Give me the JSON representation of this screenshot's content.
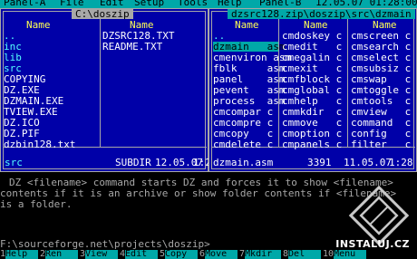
{
  "menu": {
    "items": [
      "Panel-A",
      "File",
      "Edit",
      "Setup",
      "Tools",
      "Help",
      "Panel-B"
    ],
    "clock": "12.05.07 01:28:00"
  },
  "left_panel": {
    "path": "C:\\doszip",
    "col_header_1": "Name",
    "col_header_2": "Name",
    "col1": [
      "..",
      "inc",
      "lib",
      "src",
      "COPYING",
      "DZ.EXE",
      "DZMAIN.EXE",
      "TVIEW.EXE",
      "DZ.ICO",
      "DZ.PIF",
      "dzbin128.txt"
    ],
    "col2": [
      "DZSRC128.TXT",
      "README.TXT"
    ],
    "status_name": "src",
    "status_type": "SUBDIR",
    "status_date": "12.05.07",
    "status_time": "1:28"
  },
  "right_panel": {
    "path": "dzsrc128.zip\\doszip\\src\\dzmain",
    "col_header_1": "Name",
    "col_header_2": "Name",
    "col_header_3": "Name",
    "col1": [
      "..",
      "dzmain   asm",
      "cmenviron asm",
      "fblk     asm",
      "panel    asm",
      "pevent   asm",
      "process  asm",
      "cmcompar c",
      "cmcompre c",
      "cmcopy   c",
      "cmdelete c"
    ],
    "col2": [
      "cmdoskey c",
      "cmedit   c",
      "cmegalin c",
      "cmexit   c",
      "cmfblock c",
      "cmglobal c",
      "cmhelp   c",
      "cmmkdir  c",
      "cmmove   c",
      "cmoption c",
      "cmpanels c"
    ],
    "col3": [
      "cmscreen c",
      "cmsearch c",
      "cmselect c",
      "cmsubsiz c",
      "cmswap   c",
      "cmtoggle c",
      "cmtools  c",
      "cmview   c",
      "command  c",
      "config   c",
      "filter   c"
    ],
    "status_name": "dzmain.asm",
    "status_size": "3391",
    "status_date": "11.05.07",
    "status_time": "1:28"
  },
  "message": {
    "line1": "DZ <filename> command starts DZ and forces it to show <filename>",
    "line2": "contents if it is an archive or show folder contents if <filename>",
    "line3": "is a folder."
  },
  "command_line": "F:\\sourceforge.net\\projects\\doszip>",
  "function_keys": [
    {
      "num": "1",
      "label": "Help"
    },
    {
      "num": "2",
      "label": "Ren"
    },
    {
      "num": "3",
      "label": "View"
    },
    {
      "num": "4",
      "label": "Edit"
    },
    {
      "num": "5",
      "label": "Copy"
    },
    {
      "num": "6",
      "label": "Move"
    },
    {
      "num": "7",
      "label": "Mkdir"
    },
    {
      "num": "8",
      "label": "Del"
    },
    {
      "num": "10",
      "label": "Menu"
    }
  ],
  "watermark": {
    "text": "INSTALUJ.CZ",
    "icon": "instaluj-logo-icon"
  },
  "colors": {
    "panel_bg": "#0000a8",
    "cyan": "#00a8a8",
    "bright_cyan": "#54ffff",
    "yellow": "#ffff54",
    "gray": "#a8a8a8"
  }
}
